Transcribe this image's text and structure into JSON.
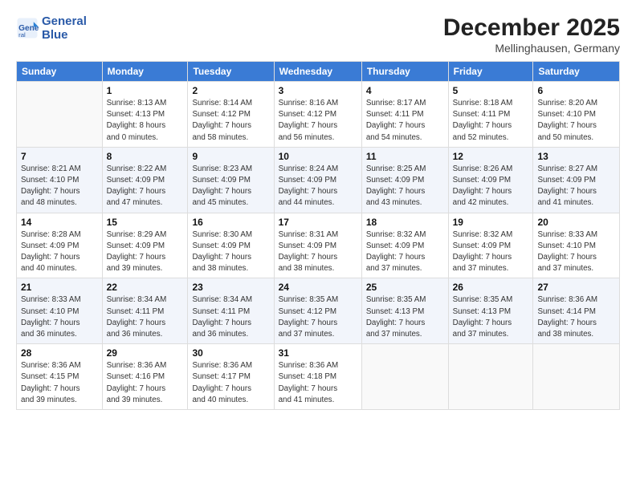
{
  "header": {
    "logo_line1": "General",
    "logo_line2": "Blue",
    "month": "December 2025",
    "location": "Mellinghausen, Germany"
  },
  "weekdays": [
    "Sunday",
    "Monday",
    "Tuesday",
    "Wednesday",
    "Thursday",
    "Friday",
    "Saturday"
  ],
  "weeks": [
    [
      {
        "day": "",
        "info": ""
      },
      {
        "day": "1",
        "info": "Sunrise: 8:13 AM\nSunset: 4:13 PM\nDaylight: 8 hours\nand 0 minutes."
      },
      {
        "day": "2",
        "info": "Sunrise: 8:14 AM\nSunset: 4:12 PM\nDaylight: 7 hours\nand 58 minutes."
      },
      {
        "day": "3",
        "info": "Sunrise: 8:16 AM\nSunset: 4:12 PM\nDaylight: 7 hours\nand 56 minutes."
      },
      {
        "day": "4",
        "info": "Sunrise: 8:17 AM\nSunset: 4:11 PM\nDaylight: 7 hours\nand 54 minutes."
      },
      {
        "day": "5",
        "info": "Sunrise: 8:18 AM\nSunset: 4:11 PM\nDaylight: 7 hours\nand 52 minutes."
      },
      {
        "day": "6",
        "info": "Sunrise: 8:20 AM\nSunset: 4:10 PM\nDaylight: 7 hours\nand 50 minutes."
      }
    ],
    [
      {
        "day": "7",
        "info": "Sunrise: 8:21 AM\nSunset: 4:10 PM\nDaylight: 7 hours\nand 48 minutes."
      },
      {
        "day": "8",
        "info": "Sunrise: 8:22 AM\nSunset: 4:09 PM\nDaylight: 7 hours\nand 47 minutes."
      },
      {
        "day": "9",
        "info": "Sunrise: 8:23 AM\nSunset: 4:09 PM\nDaylight: 7 hours\nand 45 minutes."
      },
      {
        "day": "10",
        "info": "Sunrise: 8:24 AM\nSunset: 4:09 PM\nDaylight: 7 hours\nand 44 minutes."
      },
      {
        "day": "11",
        "info": "Sunrise: 8:25 AM\nSunset: 4:09 PM\nDaylight: 7 hours\nand 43 minutes."
      },
      {
        "day": "12",
        "info": "Sunrise: 8:26 AM\nSunset: 4:09 PM\nDaylight: 7 hours\nand 42 minutes."
      },
      {
        "day": "13",
        "info": "Sunrise: 8:27 AM\nSunset: 4:09 PM\nDaylight: 7 hours\nand 41 minutes."
      }
    ],
    [
      {
        "day": "14",
        "info": "Sunrise: 8:28 AM\nSunset: 4:09 PM\nDaylight: 7 hours\nand 40 minutes."
      },
      {
        "day": "15",
        "info": "Sunrise: 8:29 AM\nSunset: 4:09 PM\nDaylight: 7 hours\nand 39 minutes."
      },
      {
        "day": "16",
        "info": "Sunrise: 8:30 AM\nSunset: 4:09 PM\nDaylight: 7 hours\nand 38 minutes."
      },
      {
        "day": "17",
        "info": "Sunrise: 8:31 AM\nSunset: 4:09 PM\nDaylight: 7 hours\nand 38 minutes."
      },
      {
        "day": "18",
        "info": "Sunrise: 8:32 AM\nSunset: 4:09 PM\nDaylight: 7 hours\nand 37 minutes."
      },
      {
        "day": "19",
        "info": "Sunrise: 8:32 AM\nSunset: 4:09 PM\nDaylight: 7 hours\nand 37 minutes."
      },
      {
        "day": "20",
        "info": "Sunrise: 8:33 AM\nSunset: 4:10 PM\nDaylight: 7 hours\nand 37 minutes."
      }
    ],
    [
      {
        "day": "21",
        "info": "Sunrise: 8:33 AM\nSunset: 4:10 PM\nDaylight: 7 hours\nand 36 minutes."
      },
      {
        "day": "22",
        "info": "Sunrise: 8:34 AM\nSunset: 4:11 PM\nDaylight: 7 hours\nand 36 minutes."
      },
      {
        "day": "23",
        "info": "Sunrise: 8:34 AM\nSunset: 4:11 PM\nDaylight: 7 hours\nand 36 minutes."
      },
      {
        "day": "24",
        "info": "Sunrise: 8:35 AM\nSunset: 4:12 PM\nDaylight: 7 hours\nand 37 minutes."
      },
      {
        "day": "25",
        "info": "Sunrise: 8:35 AM\nSunset: 4:13 PM\nDaylight: 7 hours\nand 37 minutes."
      },
      {
        "day": "26",
        "info": "Sunrise: 8:35 AM\nSunset: 4:13 PM\nDaylight: 7 hours\nand 37 minutes."
      },
      {
        "day": "27",
        "info": "Sunrise: 8:36 AM\nSunset: 4:14 PM\nDaylight: 7 hours\nand 38 minutes."
      }
    ],
    [
      {
        "day": "28",
        "info": "Sunrise: 8:36 AM\nSunset: 4:15 PM\nDaylight: 7 hours\nand 39 minutes."
      },
      {
        "day": "29",
        "info": "Sunrise: 8:36 AM\nSunset: 4:16 PM\nDaylight: 7 hours\nand 39 minutes."
      },
      {
        "day": "30",
        "info": "Sunrise: 8:36 AM\nSunset: 4:17 PM\nDaylight: 7 hours\nand 40 minutes."
      },
      {
        "day": "31",
        "info": "Sunrise: 8:36 AM\nSunset: 4:18 PM\nDaylight: 7 hours\nand 41 minutes."
      },
      {
        "day": "",
        "info": ""
      },
      {
        "day": "",
        "info": ""
      },
      {
        "day": "",
        "info": ""
      }
    ]
  ]
}
